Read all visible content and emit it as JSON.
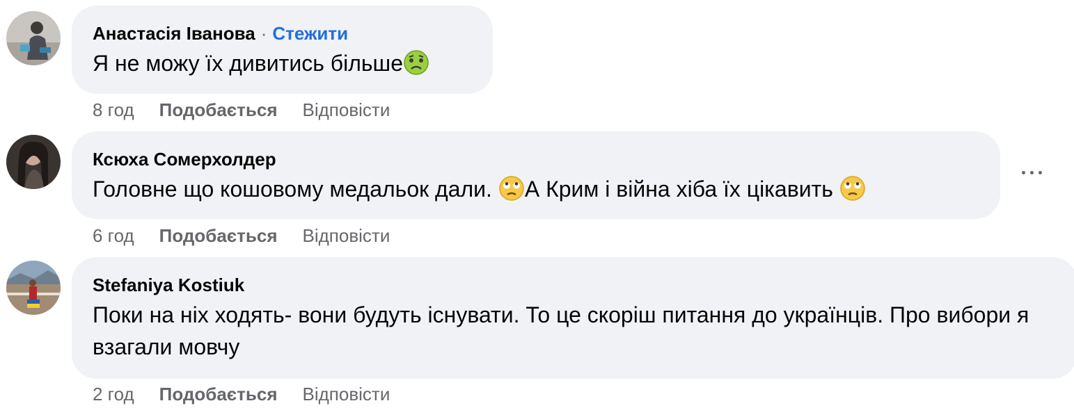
{
  "comments": [
    {
      "author": "Анастасія Іванова",
      "separator": "·",
      "follow_label": "Стежити",
      "text": "Я не можу їх дивитись більше",
      "emoji": "nauseated-face-emoji",
      "time": "8 год",
      "like_label": "Подобається",
      "reply_label": "Відповісти"
    },
    {
      "author": "Ксюха Сомерхолдер",
      "text_part1": "Головне що кошовому медальок дали.",
      "text_part2": "А Крим і війна хіба їх цікавить",
      "emoji": "eye-roll-face-emoji",
      "time": "6 год",
      "like_label": "Подобається",
      "reply_label": "Відповісти",
      "more_icon": "more-options-icon"
    },
    {
      "author": "Stefaniya Kostiuk",
      "text": "Поки на ніх ходять- вони будуть існувати. То це скоріш питання до українців. Про вибори я взагали мовчу",
      "time": "2 год",
      "like_label": "Подобається",
      "reply_label": "Відповісти"
    }
  ],
  "colors": {
    "bubble": "#f0f2f5",
    "link": "#216fdb",
    "meta": "#65676b",
    "text": "#050505"
  }
}
